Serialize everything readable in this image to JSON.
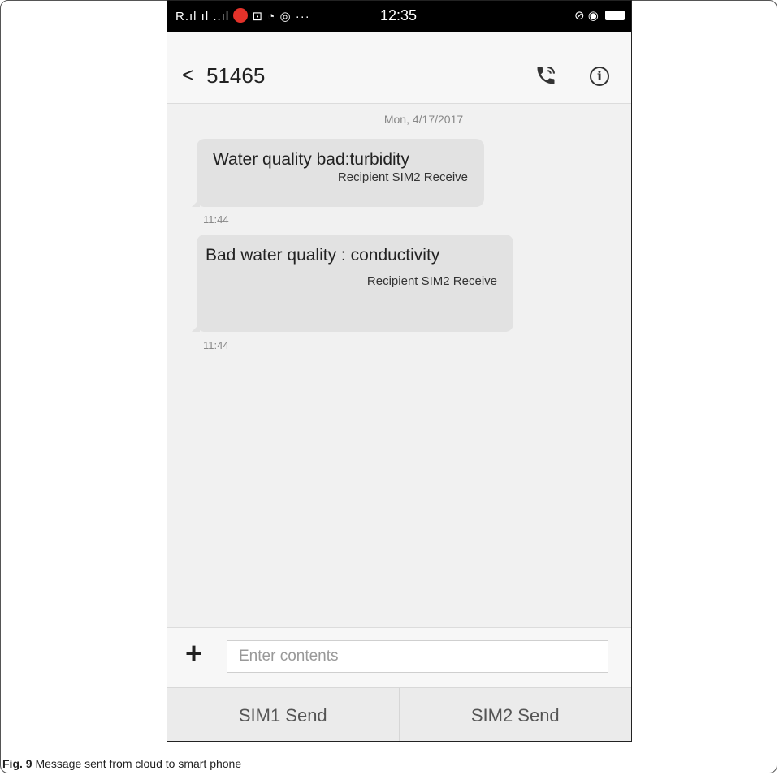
{
  "statusbar": {
    "left_icons": "R.ıl ıl ..ıl",
    "extra_icons": "⊡ ◔ ◎ ···",
    "time": "12:35",
    "right_icons": "⊘ ◉"
  },
  "header": {
    "back_symbol": "<",
    "title": "51465"
  },
  "conversation": {
    "date": "Mon, 4/17/2017",
    "messages": [
      {
        "text": "Water quality bad:turbidity",
        "sub": "Recipient SIM2 Receive",
        "time": "11:44"
      },
      {
        "text": "Bad water quality : conductivity",
        "sub": "Recipient SIM2 Receive",
        "time": "11:44"
      }
    ]
  },
  "composer": {
    "plus": "+",
    "placeholder": "Enter contents"
  },
  "send_buttons": {
    "sim1": "SIM1 Send",
    "sim2": "SIM2 Send"
  },
  "caption": {
    "label": "Fig. 9",
    "text": " Message sent from cloud to smart phone"
  },
  "icons": {
    "call": "phone-call-icon",
    "info": "info-icon",
    "mute": "mute-icon",
    "eye": "eye-icon",
    "battery": "battery-icon"
  }
}
